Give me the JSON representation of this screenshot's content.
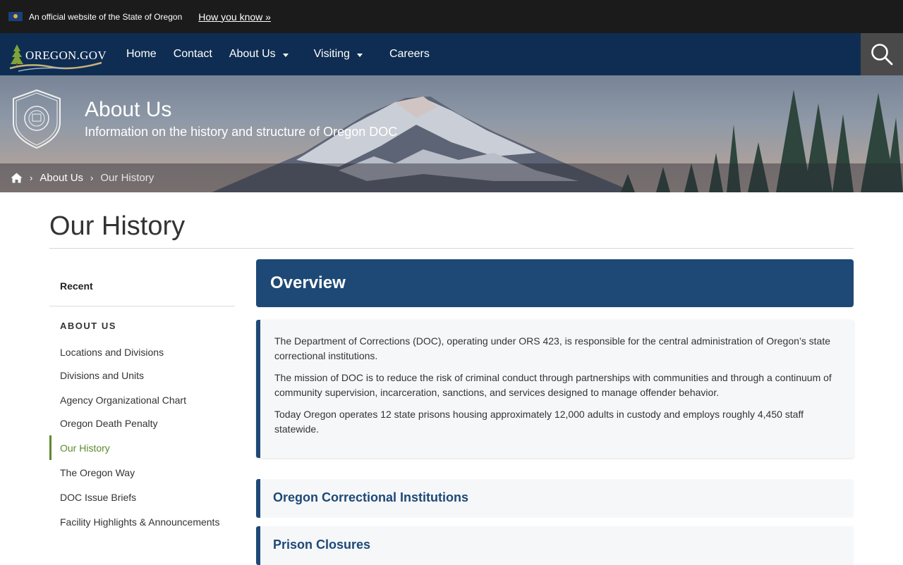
{
  "gov_banner": {
    "official_text": "An official website of the State of Oregon",
    "how_you_know": "How you know »"
  },
  "nav": {
    "logo_text": "Oregon.gov",
    "links": [
      {
        "label": "Home",
        "dropdown": false
      },
      {
        "label": "Contact",
        "dropdown": false
      },
      {
        "label": "About Us",
        "dropdown": true
      },
      {
        "label": "Visiting",
        "dropdown": true
      },
      {
        "label": "Careers",
        "dropdown": false
      }
    ],
    "search_icon": "search-icon"
  },
  "hero": {
    "title": "About Us",
    "subtitle": "Information on the history and structure of Oregon DOC",
    "breadcrumb": {
      "home_icon": "home-icon",
      "items": [
        "About Us",
        "Our History"
      ]
    }
  },
  "page": {
    "title": "Our History"
  },
  "sidebar": {
    "recent": "Recent",
    "heading": "ABOUT US",
    "items": [
      "Locations and Divisions",
      "Divisions and Units",
      "Agency Organizational Chart",
      "Oregon Death Penalty",
      "Our History",
      "The Oregon Way",
      "DOC Issue Briefs",
      "Facility Highlights & Announcements"
    ],
    "active_item": "Our History"
  },
  "content": {
    "overview_heading": "Overview",
    "paragraphs": [
      "The Department of Corrections (DOC), operating under ORS 423, is responsible for the central administration of Oregon’s state correctional institutions.",
      "The mission of DOC is to reduce the risk of criminal conduct through partnerships with communities and through a continuum of community supervision, incarceration, sanctions, and services designed to manage offender behavior.",
      "Today Oregon operates 12 state prisons housing approximately 12,000 adults in custody and employs roughly 4,450 staff statewide."
    ],
    "accordions": [
      "Oregon Correctional Institutions",
      "Prison Closures"
    ]
  },
  "colors": {
    "nav_bg": "#0f2d52",
    "accent_blue": "#1e4976",
    "active_green": "#5d8a2e"
  }
}
